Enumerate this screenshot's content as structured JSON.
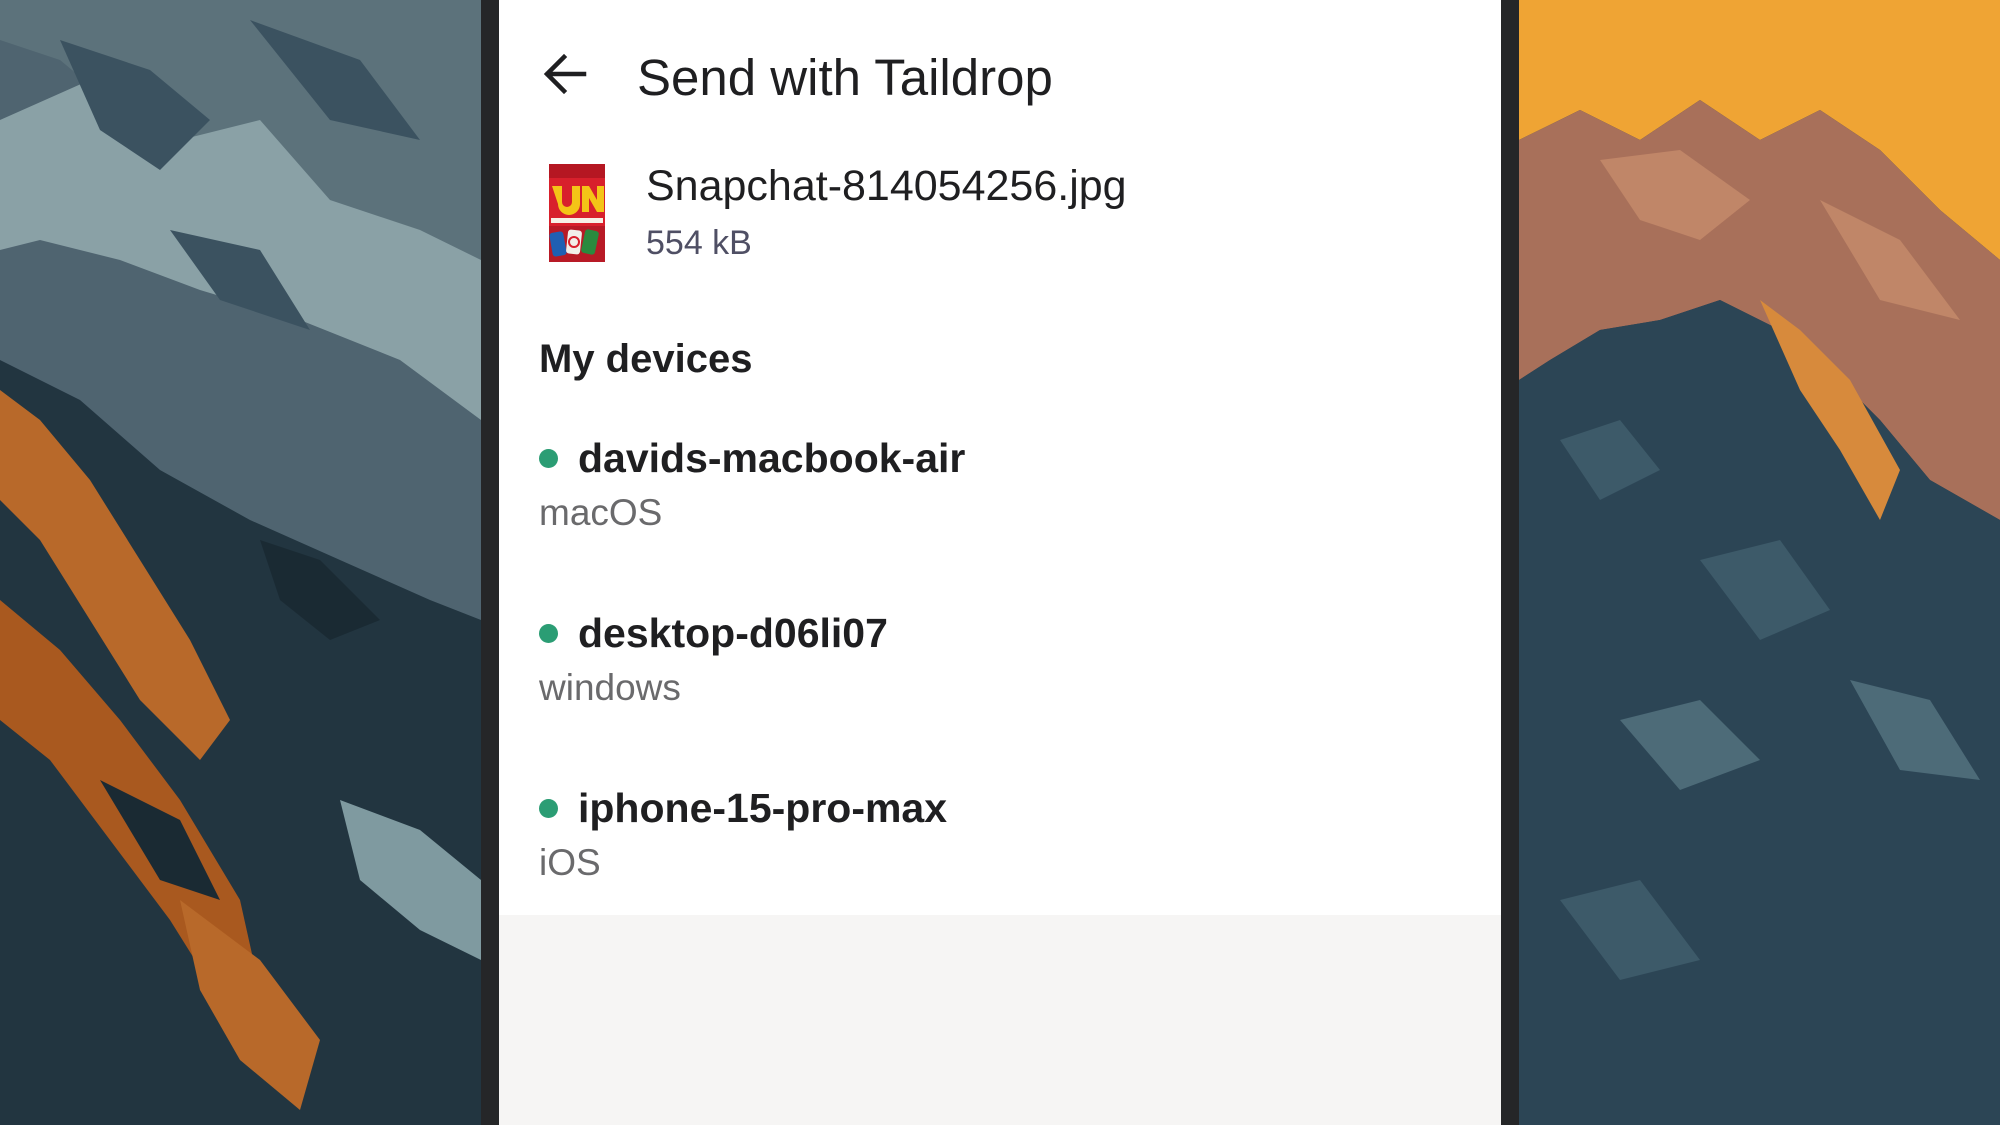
{
  "header": {
    "back_icon": "arrow-left-icon",
    "title": "Send with Taildrop"
  },
  "file": {
    "thumbnail_icon": "image-thumbnail",
    "name": "Snapchat-814054256.jpg",
    "size": "554 kB"
  },
  "devices_section": {
    "heading": "My devices",
    "status_color": "#2b9d74",
    "items": [
      {
        "name": "davids-macbook-air",
        "os": "macOS"
      },
      {
        "name": "desktop-d06li07",
        "os": "windows"
      },
      {
        "name": "iphone-15-pro-max",
        "os": "iOS"
      }
    ]
  },
  "colors": {
    "sheet_background": "#ffffff",
    "screen_background": "#f6f5f4",
    "bezel": "#252628",
    "primary_text": "#1f1f21",
    "secondary_text": "#6a6a6c",
    "online_indicator": "#2b9d74"
  }
}
